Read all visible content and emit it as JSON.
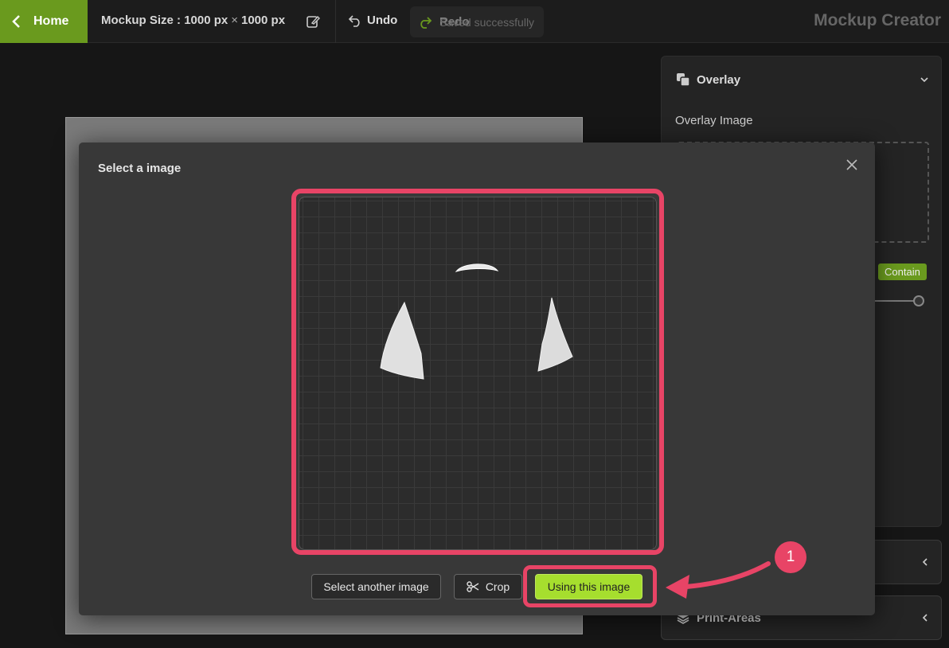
{
  "topbar": {
    "home_label": "Home",
    "size_prefix": "Mockup Size :",
    "width": "1000 px",
    "times": "×",
    "height": "1000 px",
    "undo_label": "Undo",
    "redo_label": "Redo",
    "toast_message": "Saved successfully",
    "app_title": "Mockup Creator"
  },
  "side_panel": {
    "overlay_title": "Overlay",
    "overlay_image_label": "Overlay Image",
    "contain_label": "Contain",
    "print_areas_label": "Print-Areas"
  },
  "modal": {
    "title": "Select a image",
    "select_another_label": "Select another image",
    "crop_label": "Crop",
    "use_image_label": "Using this image"
  },
  "annotation": {
    "step_number": "1",
    "highlight_color": "#e84466"
  },
  "colors": {
    "accent_green": "#6a9a1e",
    "primary_button": "#a6de2e"
  }
}
